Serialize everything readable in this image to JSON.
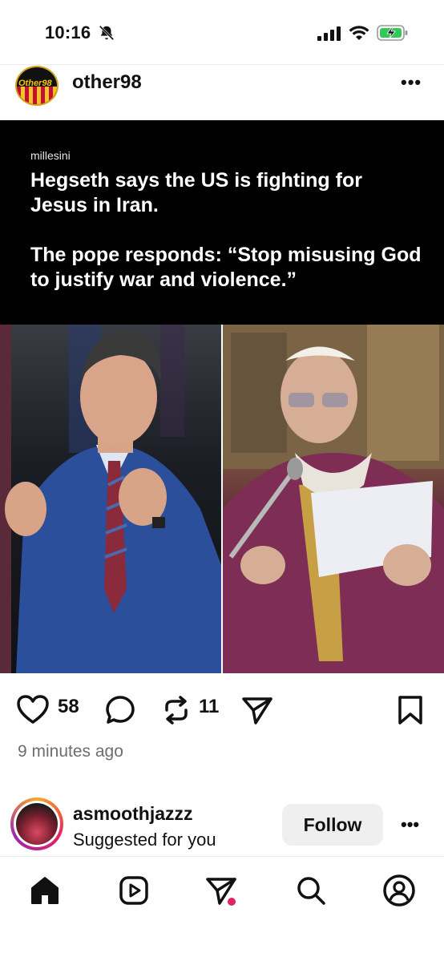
{
  "status_bar": {
    "time": "10:16"
  },
  "post": {
    "username": "other98",
    "avatar_text": "Other98",
    "image": {
      "source_handle": "millesini",
      "headline": "Hegseth says the US is fighting for Jesus in Iran.\n\nThe pope responds: “Stop misusing God to justify war and violence.”"
    },
    "likes": "58",
    "reposts": "11",
    "timestamp": "9 minutes ago"
  },
  "suggested": {
    "username": "asmoothjazzz",
    "subtitle": "Suggested for you",
    "follow_label": "Follow"
  },
  "colors": {
    "notification_dot": "#e0245e",
    "battery_green": "#34c759"
  }
}
